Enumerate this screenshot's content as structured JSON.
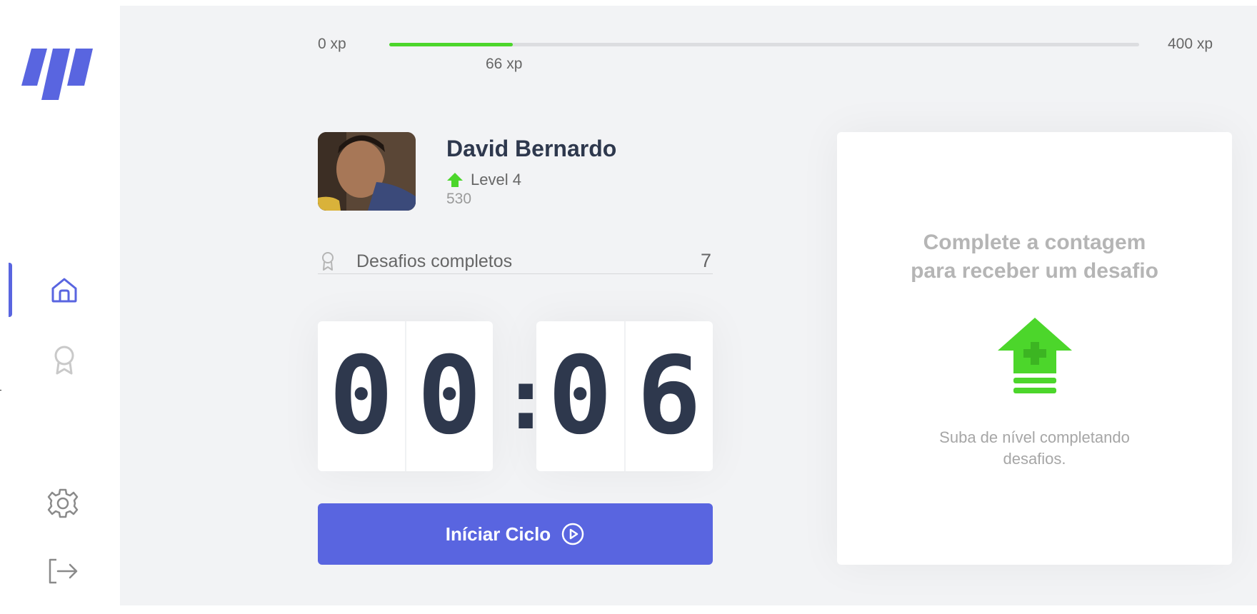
{
  "app": {
    "colors": {
      "accent": "#5965e0",
      "green": "#4cd62b",
      "title": "#2e384d",
      "text": "#666666",
      "background": "#f2f3f5"
    }
  },
  "sidebar": {
    "items": [
      {
        "name": "home",
        "icon": "home-icon",
        "active": true
      },
      {
        "name": "leaderboard",
        "icon": "award-icon",
        "active": false
      },
      {
        "name": "settings",
        "icon": "gear-icon",
        "active": false
      },
      {
        "name": "logout",
        "icon": "logout-icon",
        "active": false
      }
    ]
  },
  "experience": {
    "min_label": "0 xp",
    "max_label": "400 xp",
    "current_label": "66 xp",
    "current": 66,
    "max": 400
  },
  "profile": {
    "name": "David Bernardo",
    "level_label": "Level 4",
    "total_xp": "530"
  },
  "challenges": {
    "label": "Desafios completos",
    "count": "7"
  },
  "countdown": {
    "minutes": [
      "0",
      "0"
    ],
    "separator": ":",
    "seconds": [
      "0",
      "6"
    ]
  },
  "start_button": {
    "label": "Iníciar Ciclo",
    "icon": "play-circle-icon"
  },
  "challenge_box": {
    "title_line1": "Complete a contagem",
    "title_line2": "para receber um desafio",
    "icon": "level-up-icon",
    "hint_line1": "Suba de nível completando",
    "hint_line2": "desafios."
  }
}
